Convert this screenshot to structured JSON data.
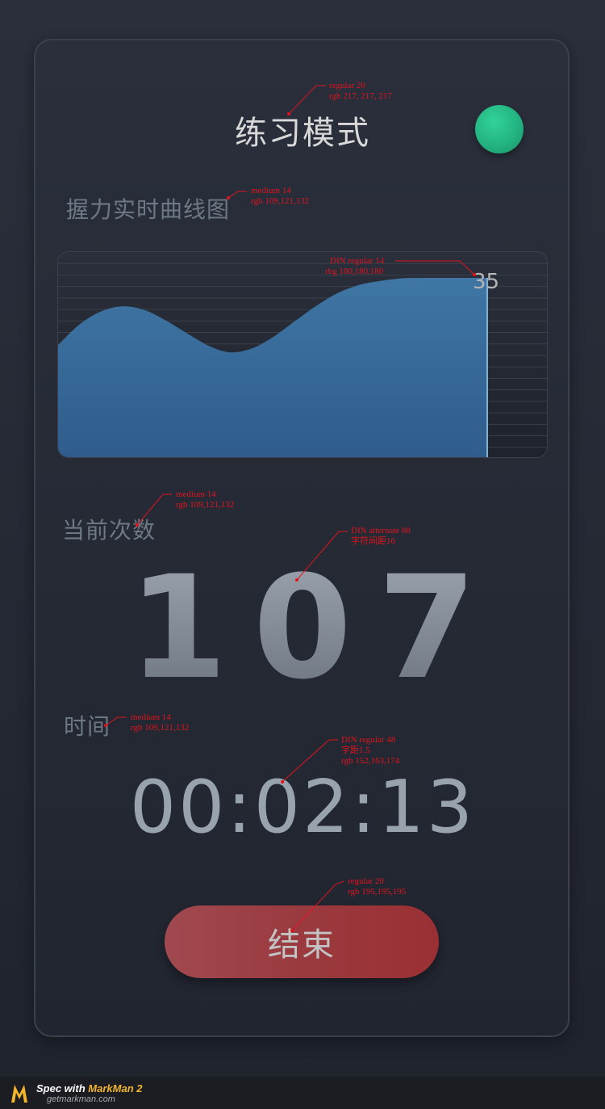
{
  "header": {
    "title": "练习模式"
  },
  "chart_section": {
    "label": "握力实时曲线图"
  },
  "chart_data": {
    "type": "area",
    "title": "",
    "xlabel": "",
    "ylabel": "",
    "peak_label": "35",
    "fill_color": "#3a6e99",
    "x": [
      0,
      1,
      2,
      3,
      4,
      5,
      6,
      7,
      8,
      9,
      10,
      11,
      12,
      13,
      14,
      15,
      16,
      17,
      18,
      19,
      20
    ],
    "values": [
      22,
      26,
      28.5,
      29.5,
      28.8,
      26.8,
      24.3,
      21.9,
      20.6,
      21.3,
      23.5,
      26.5,
      29.5,
      32,
      33.6,
      34.4,
      34.9,
      35,
      35,
      35,
      35
    ],
    "ylim": [
      0,
      40
    ],
    "grid": true
  },
  "count_section": {
    "label": "当前次数",
    "value": "107"
  },
  "time_section": {
    "label": "时间",
    "value": "00:02:13"
  },
  "controls": {
    "end_label": "结束"
  },
  "annotations": [
    {
      "lines": [
        "regular 20",
        "rgb 217,   217,   217"
      ]
    },
    {
      "lines": [
        "medium 14",
        "rgb 109,121,132"
      ]
    },
    {
      "lines": [
        "DIN regular 14",
        "rbg 180,180,180"
      ]
    },
    {
      "lines": [
        "medium 14",
        "rgb 109,121,132"
      ]
    },
    {
      "lines": [
        "DIN alternate 88",
        "字符间距16"
      ]
    },
    {
      "lines": [
        "medium 14",
        "rgb 109,121,132"
      ]
    },
    {
      "lines": [
        "DIN regular 48",
        "字距1.5",
        "rgb 152,163,174"
      ]
    },
    {
      "lines": [
        "regular 20",
        "rgb 195,195,195"
      ]
    }
  ],
  "footer": {
    "brand_prefix": "Spec with ",
    "brand_name": "MarkMan 2",
    "url": "getmarkman.com"
  },
  "colors": {
    "title": "#d9d9d9",
    "label": "#6d7984",
    "timer": "#98a3ae",
    "status_dot": "#22b07e",
    "end_button": "#9a3a3f",
    "annotation": "#e0141e"
  },
  "icons": {
    "status": "green-status-dot",
    "footer_logo": "markman-logo-icon"
  }
}
